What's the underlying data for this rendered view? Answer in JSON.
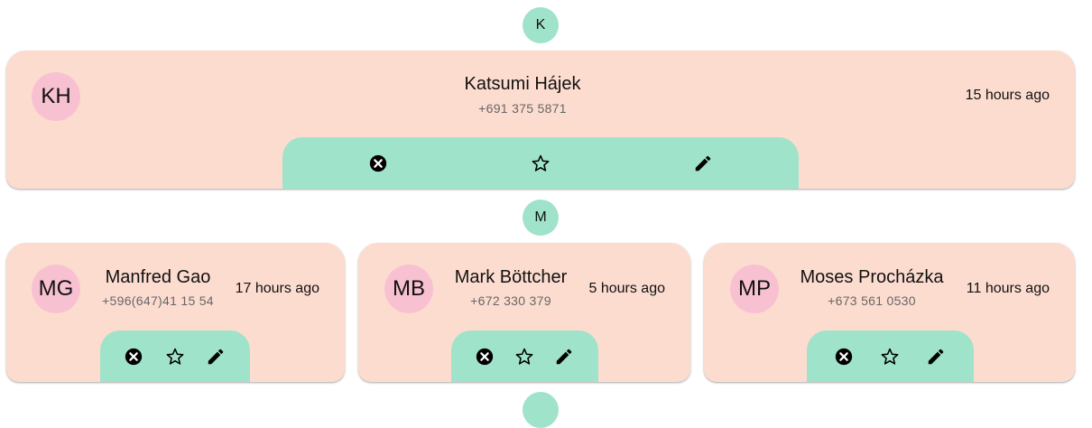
{
  "sections": [
    {
      "letter": "K",
      "contacts": [
        {
          "initials": "KH",
          "name": "Katsumi Hájek",
          "phone": "+691 375 5871",
          "time": "15 hours ago"
        }
      ]
    },
    {
      "letter": "M",
      "contacts": [
        {
          "initials": "MG",
          "name": "Manfred Gao",
          "phone": "+596(647)41 15 54",
          "time": "17 hours ago"
        },
        {
          "initials": "MB",
          "name": "Mark Böttcher",
          "phone": "+672 330 379",
          "time": "5 hours ago"
        },
        {
          "initials": "MP",
          "name": "Moses Procházka",
          "phone": "+673 561 0530",
          "time": "11 hours ago"
        }
      ]
    }
  ],
  "icons": {
    "delete": "cancel-icon",
    "favorite": "star-outline-icon",
    "edit": "pencil-icon"
  },
  "colors": {
    "card_bg": "#fddcd0",
    "accent": "#9fe3ca",
    "avatar_bg": "#f8c1d1"
  }
}
